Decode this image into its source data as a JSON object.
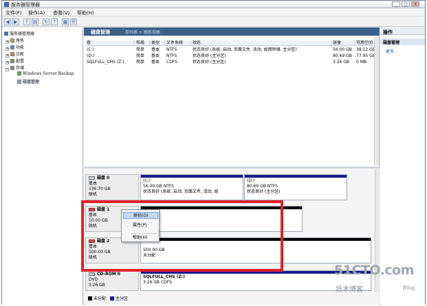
{
  "window": {
    "title": "服务器管理器",
    "controls": [
      "_",
      "□",
      "X"
    ]
  },
  "menubar": [
    "文件(F)",
    "操作(A)",
    "查看(V)",
    "帮助(H)"
  ],
  "toolbar": [
    "back-icon",
    "forward-icon",
    "up-icon",
    "show-hide-tree-icon",
    "refresh-icon",
    "help-icon",
    "export-icon",
    "properties-icon"
  ],
  "tree": {
    "root": "服务器管理器",
    "items": [
      "角色",
      "功能",
      "诊断",
      "配置",
      "存储"
    ],
    "storage_children": [
      "Windows Server Backup",
      "磁盘管理"
    ]
  },
  "center": {
    "header": "磁盘管理",
    "subheader": "卷列表 + 图形视图",
    "columns": [
      "卷",
      "布局",
      "类型",
      "文件系统",
      "状态",
      "容量",
      "可用空间"
    ],
    "volumes": [
      {
        "volume": "(C:)",
        "layout": "简单",
        "type": "基本",
        "fs": "NTFS",
        "status": "状态良好 (系统, 启动, 页面文件, 活动, 故障转储, 主分区)",
        "capacity": "56.00 GB",
        "free": "38.12 GB"
      },
      {
        "volume": "(D:)",
        "layout": "简单",
        "type": "基本",
        "fs": "NTFS",
        "status": "状态良好 (主分区)",
        "capacity": "80.69 GB",
        "free": "77.95 GB"
      },
      {
        "volume": "SQLFULL_CHS (Z:)",
        "layout": "简单",
        "type": "基本",
        "fs": "CDFS",
        "status": "状态良好 (主分区)",
        "capacity": "3.26 GB",
        "free": "0 MB"
      }
    ],
    "disks": [
      {
        "name": "磁盘 0",
        "kind": "基本",
        "size": "136.70 GB",
        "state": "联机",
        "partitions": [
          {
            "label": "(C:)",
            "size_fs": "56.00 GB NTFS",
            "status": "状态良好 (系统, 启动, 页面文件, 活动, 故"
          },
          {
            "label": "(D:)",
            "size_fs": "80.69 GB NTFS",
            "status": "状态良好 (主分区)"
          }
        ]
      },
      {
        "name": "磁盘 1",
        "kind": "基本",
        "size": "10.00 GB",
        "state": "脱机",
        "partitions": [
          {
            "label": "",
            "size_fs": "",
            "status": ""
          }
        ]
      },
      {
        "name": "磁盘 2",
        "kind": "基本",
        "size": "500.00 GB",
        "state": "联机",
        "partitions": [
          {
            "label": "",
            "size_fs": "500.00 GB",
            "status": "未分配"
          }
        ]
      },
      {
        "name": "CD-ROM 0",
        "kind": "DVD",
        "size": "3.26 GB",
        "state": "",
        "partitions": [
          {
            "label": "SQLFULL_CHS (Z:)",
            "size_fs": "3.26 GB CDFS",
            "status": ""
          }
        ]
      }
    ],
    "legend": [
      {
        "label": "未分配",
        "color": "#000000"
      },
      {
        "label": "主分区",
        "color": "#1a1a8c"
      }
    ]
  },
  "context_menu": {
    "items": [
      "联机(O)",
      "属性(P)",
      "帮助(H)"
    ]
  },
  "actions": {
    "header": "操作",
    "section": "磁盘管理",
    "more": "更多..."
  },
  "watermark": {
    "site": "51CTO.com",
    "tagline": "技术博客",
    "blog": "Blog"
  },
  "colors": {
    "header_bg": "#3e5f8a",
    "primary_partition": "#1a1a8c",
    "unallocated": "#000000",
    "highlight_frame": "#e0212a"
  }
}
